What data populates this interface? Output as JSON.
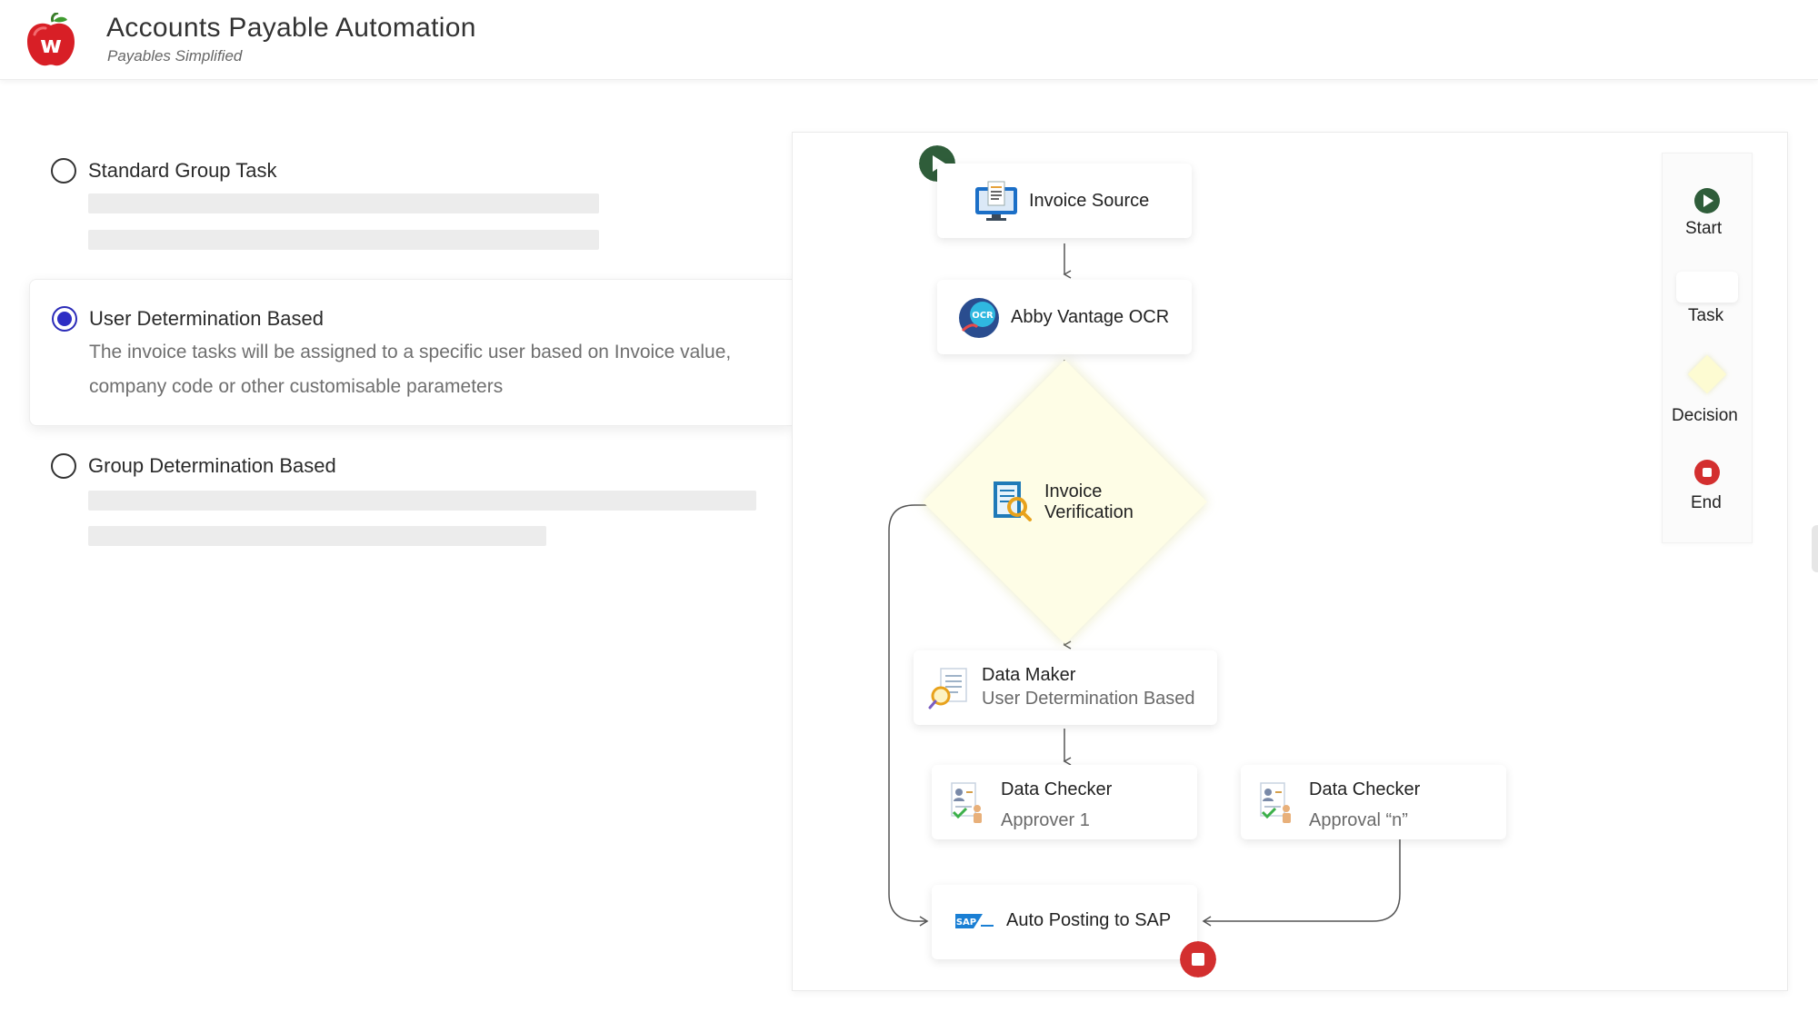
{
  "header": {
    "title": "Accounts Payable Automation",
    "subtitle": "Payables Simplified",
    "logo_letter": "w"
  },
  "options": [
    {
      "label": "Standard Group Task",
      "selected": false
    },
    {
      "label": "User Determination Based",
      "selected": true,
      "description_line1": "The invoice tasks will be assigned to a specific user based on Invoice value,",
      "description_line2": "company code or other customisable parameters"
    },
    {
      "label": "Group Determination Based",
      "selected": false
    }
  ],
  "flow": {
    "invoice_source": "Invoice Source",
    "ocr": "Abby Vantage OCR",
    "ocr_badge": "OCR",
    "verification_line1": "Invoice",
    "verification_line2": "Verification",
    "data_maker": "Data Maker",
    "data_maker_sub": "User Determination Based",
    "checker1": "Data Checker",
    "checker1_sub": "Approver 1",
    "checker2": "Data Checker",
    "checker2_sub": "Approval “n”",
    "auto_posting": "Auto Posting to SAP",
    "sap_badge": "SAP"
  },
  "legend": {
    "start": "Start",
    "task": "Task",
    "decision": "Decision",
    "end": "End"
  },
  "colors": {
    "start_green": "#2f5d3a",
    "end_red": "#d32f2f",
    "radio_selected": "#2d2dc4",
    "decision_fill": "#fefde6"
  }
}
